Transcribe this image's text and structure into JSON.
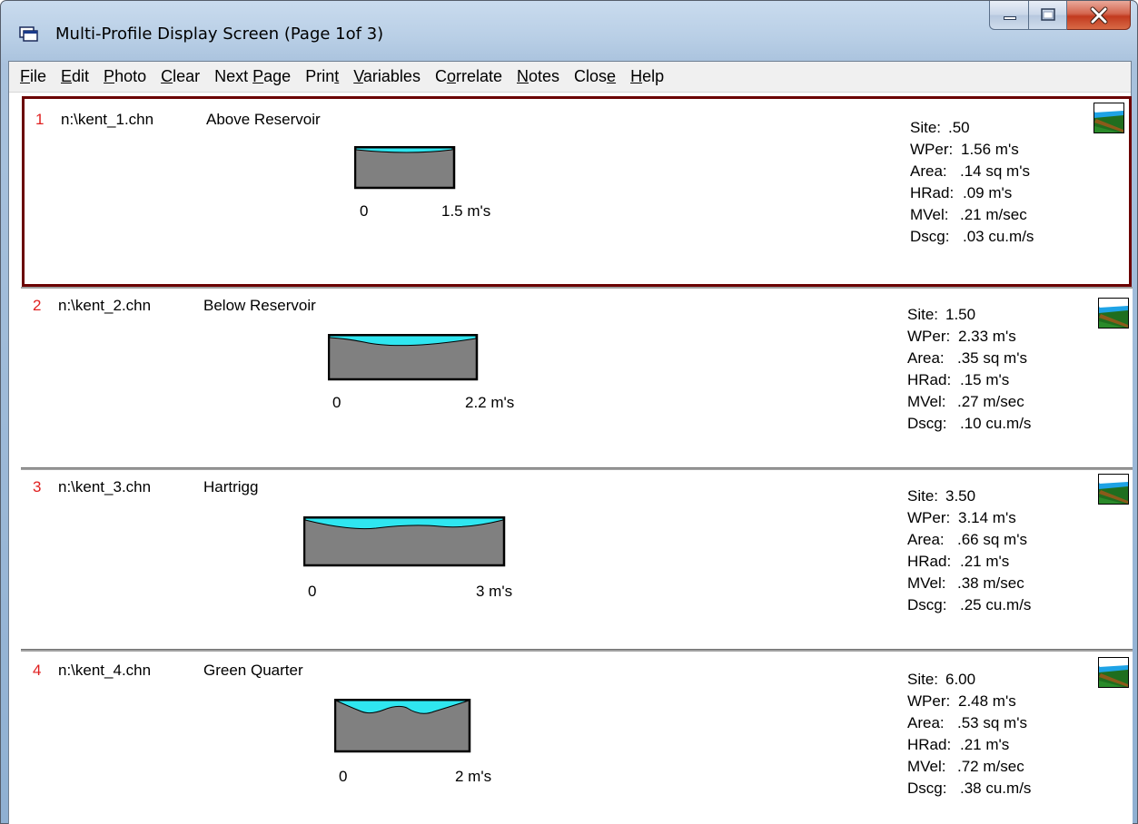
{
  "window": {
    "title": "Multi-Profile Display Screen (Page 1of 3)"
  },
  "menu": [
    {
      "pre": "",
      "key": "F",
      "post": "ile"
    },
    {
      "pre": "",
      "key": "E",
      "post": "dit"
    },
    {
      "pre": "",
      "key": "P",
      "post": "hoto"
    },
    {
      "pre": "",
      "key": "C",
      "post": "lear"
    },
    {
      "pre": "Next ",
      "key": "P",
      "post": "age"
    },
    {
      "pre": "Prin",
      "key": "t",
      "post": ""
    },
    {
      "pre": "",
      "key": "V",
      "post": "ariables"
    },
    {
      "pre": "C",
      "key": "o",
      "post": "rrelate"
    },
    {
      "pre": "",
      "key": "N",
      "post": "otes"
    },
    {
      "pre": "Clos",
      "key": "e",
      "post": ""
    },
    {
      "pre": "",
      "key": "H",
      "post": "elp"
    }
  ],
  "profiles": [
    {
      "number": "1",
      "file": "n:\\kent_1.chn",
      "name": "Above Reservoir",
      "scale_start": "0",
      "scale_end": "1.5 m's",
      "stats": [
        {
          "label": "Site:",
          "value": ".50"
        },
        {
          "label": "WPer:",
          "value": "1.56 m's"
        },
        {
          "label": "Area:",
          "value": ".14 sq m's"
        },
        {
          "label": "HRad:",
          "value": ".09 m's"
        },
        {
          "label": "MVel:",
          "value": ".21 m/sec"
        },
        {
          "label": "Dscg:",
          "value": ".03 cu.m/s"
        }
      ]
    },
    {
      "number": "2",
      "file": "n:\\kent_2.chn",
      "name": "Below Reservoir",
      "scale_start": "0",
      "scale_end": "2.2 m's",
      "stats": [
        {
          "label": "Site:",
          "value": "1.50"
        },
        {
          "label": "WPer:",
          "value": "2.33 m's"
        },
        {
          "label": "Area:",
          "value": ".35 sq m's"
        },
        {
          "label": "HRad:",
          "value": ".15 m's"
        },
        {
          "label": "MVel:",
          "value": ".27 m/sec"
        },
        {
          "label": "Dscg:",
          "value": ".10 cu.m/s"
        }
      ]
    },
    {
      "number": "3",
      "file": "n:\\kent_3.chn",
      "name": "Hartrigg",
      "scale_start": "0",
      "scale_end": "3 m's",
      "stats": [
        {
          "label": "Site:",
          "value": "3.50"
        },
        {
          "label": "WPer:",
          "value": "3.14 m's"
        },
        {
          "label": "Area:",
          "value": ".66 sq m's"
        },
        {
          "label": "HRad:",
          "value": ".21 m's"
        },
        {
          "label": "MVel:",
          "value": ".38 m/sec"
        },
        {
          "label": "Dscg:",
          "value": ".25 cu.m/s"
        }
      ]
    },
    {
      "number": "4",
      "file": "n:\\kent_4.chn",
      "name": "Green Quarter",
      "scale_start": "0",
      "scale_end": "2 m's",
      "stats": [
        {
          "label": "Site:",
          "value": "6.00"
        },
        {
          "label": "WPer:",
          "value": "2.48 m's"
        },
        {
          "label": "Area:",
          "value": ".53 sq m's"
        },
        {
          "label": "HRad:",
          "value": ".21 m's"
        },
        {
          "label": "MVel:",
          "value": ".72 m/sec"
        },
        {
          "label": "Dscg:",
          "value": ".38 cu.m/s"
        }
      ]
    }
  ],
  "colors": {
    "water": "#2fe6f0",
    "channel_bed": "#808080",
    "profile_number": "#e02020",
    "selected_border": "#6b0000"
  }
}
